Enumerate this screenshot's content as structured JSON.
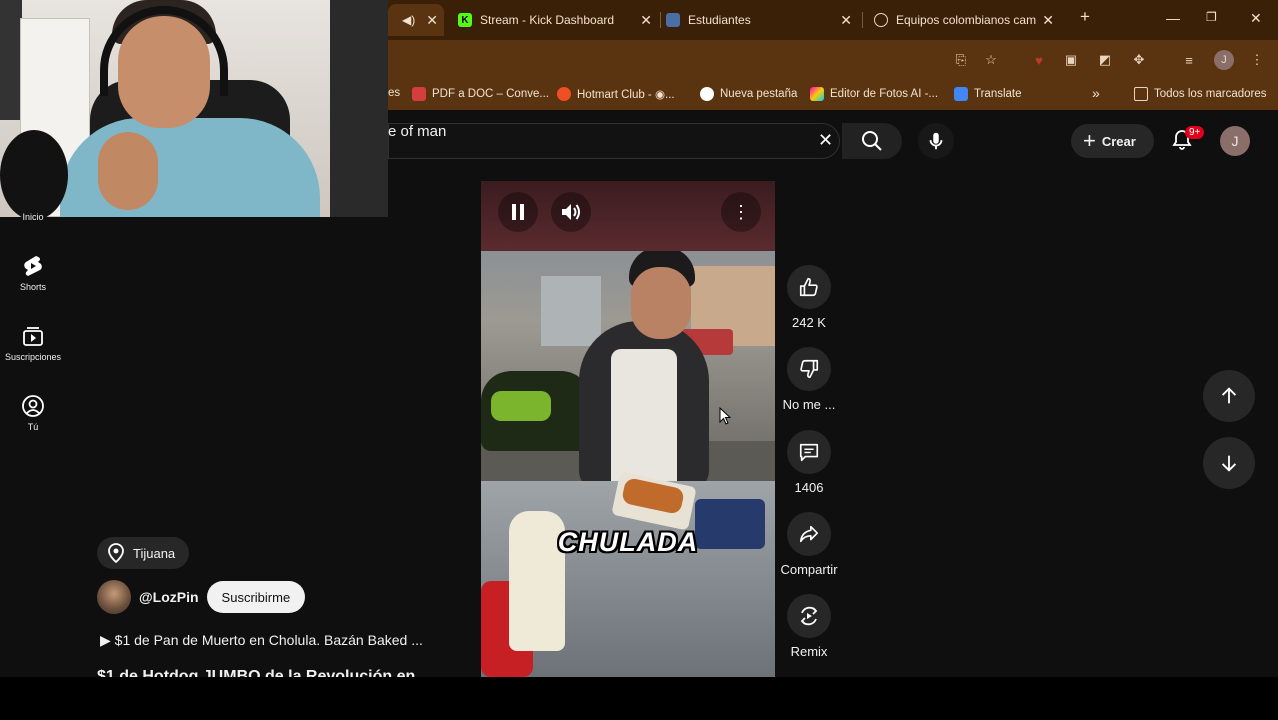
{
  "browser": {
    "tabs": [
      {
        "label": "",
        "icon": "speaker-icon"
      },
      {
        "label": "Stream - Kick Dashboard",
        "icon": "kick-icon"
      },
      {
        "label": "Estudiantes",
        "icon": "shield-icon"
      },
      {
        "label": "Equipos colombianos camp",
        "icon": "globe-icon"
      }
    ],
    "new_tab": "+",
    "bookmarks": [
      {
        "label": "es"
      },
      {
        "label": "PDF a DOC – Conve..."
      },
      {
        "label": "Hotmart Club - ◉..."
      },
      {
        "label": "Nueva pestaña"
      },
      {
        "label": "Editor de Fotos AI -..."
      },
      {
        "label": "Translate"
      }
    ],
    "bookmarks_more": "»",
    "all_bookmarks": "Todos los marcadores",
    "profile_initial": "J",
    "accent_color": "#5a3410"
  },
  "youtube": {
    "search_value": "e of man",
    "create_label": "Crear",
    "notification_count": "9+",
    "avatar_initial": "J",
    "sidebar": [
      {
        "label": "Inicio"
      },
      {
        "label": "Shorts"
      },
      {
        "label": "Suscripciones"
      },
      {
        "label": "Tú"
      }
    ],
    "location": "Tijuana",
    "channel": "@LozPin",
    "subscribe_label": "Suscribirme",
    "playlist_link": "▶ $1 de Pan de Muerto en Cholula. Bazán Baked ...",
    "video_title": "$1 de Hotdog JUMBO de la Revolución en",
    "caption": "CHULADA",
    "actions": {
      "likes": "242 K",
      "dislike": "No me ...",
      "comments": "1406",
      "share": "Compartir",
      "remix": "Remix"
    }
  }
}
